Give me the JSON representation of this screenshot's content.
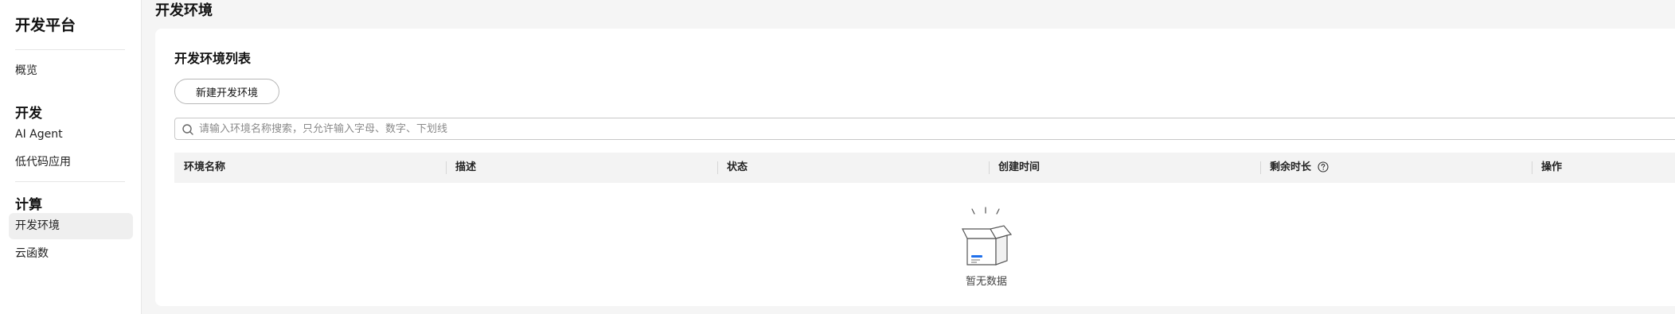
{
  "sidebar": {
    "brand": "开发平台",
    "items": [
      {
        "label": "概览"
      },
      {
        "group": "开发"
      },
      {
        "label": "AI Agent"
      },
      {
        "label": "低代码应用"
      },
      {
        "group": "计算"
      },
      {
        "label": "开发环境",
        "active": true
      },
      {
        "label": "云函数"
      }
    ]
  },
  "header": {
    "title": "开发环境"
  },
  "card": {
    "title": "开发环境列表",
    "new_button": "新建开发环境",
    "search_placeholder": "请输入环境名称搜索，只允许输入字母、数字、下划线"
  },
  "table": {
    "columns": [
      "环境名称",
      "描述",
      "状态",
      "创建时间",
      "剩余时长",
      "操作"
    ],
    "rows": [],
    "empty_text": "暂无数据"
  },
  "icons": [
    "search-icon",
    "help-icon",
    "empty-box-icon"
  ],
  "colors": {
    "accent": "#1f6feb",
    "sidebar_active_bg": "#efefef",
    "page_bg": "#f5f5f5"
  }
}
